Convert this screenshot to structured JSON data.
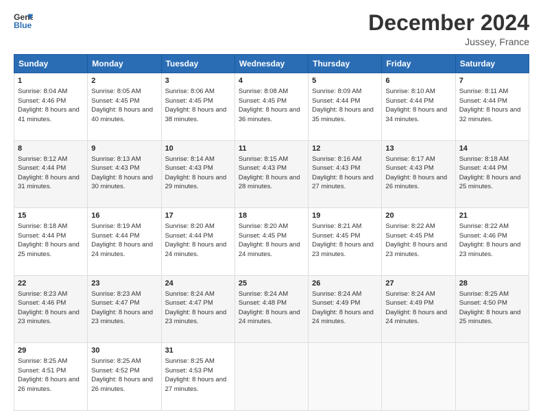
{
  "logo": {
    "line1": "General",
    "line2": "Blue"
  },
  "title": "December 2024",
  "location": "Jussey, France",
  "weekdays": [
    "Sunday",
    "Monday",
    "Tuesday",
    "Wednesday",
    "Thursday",
    "Friday",
    "Saturday"
  ],
  "weeks": [
    [
      {
        "day": "1",
        "sunrise": "8:04 AM",
        "sunset": "4:46 PM",
        "daylight": "8 hours and 41 minutes."
      },
      {
        "day": "2",
        "sunrise": "8:05 AM",
        "sunset": "4:45 PM",
        "daylight": "8 hours and 40 minutes."
      },
      {
        "day": "3",
        "sunrise": "8:06 AM",
        "sunset": "4:45 PM",
        "daylight": "8 hours and 38 minutes."
      },
      {
        "day": "4",
        "sunrise": "8:08 AM",
        "sunset": "4:45 PM",
        "daylight": "8 hours and 36 minutes."
      },
      {
        "day": "5",
        "sunrise": "8:09 AM",
        "sunset": "4:44 PM",
        "daylight": "8 hours and 35 minutes."
      },
      {
        "day": "6",
        "sunrise": "8:10 AM",
        "sunset": "4:44 PM",
        "daylight": "8 hours and 34 minutes."
      },
      {
        "day": "7",
        "sunrise": "8:11 AM",
        "sunset": "4:44 PM",
        "daylight": "8 hours and 32 minutes."
      }
    ],
    [
      {
        "day": "8",
        "sunrise": "8:12 AM",
        "sunset": "4:44 PM",
        "daylight": "8 hours and 31 minutes."
      },
      {
        "day": "9",
        "sunrise": "8:13 AM",
        "sunset": "4:43 PM",
        "daylight": "8 hours and 30 minutes."
      },
      {
        "day": "10",
        "sunrise": "8:14 AM",
        "sunset": "4:43 PM",
        "daylight": "8 hours and 29 minutes."
      },
      {
        "day": "11",
        "sunrise": "8:15 AM",
        "sunset": "4:43 PM",
        "daylight": "8 hours and 28 minutes."
      },
      {
        "day": "12",
        "sunrise": "8:16 AM",
        "sunset": "4:43 PM",
        "daylight": "8 hours and 27 minutes."
      },
      {
        "day": "13",
        "sunrise": "8:17 AM",
        "sunset": "4:43 PM",
        "daylight": "8 hours and 26 minutes."
      },
      {
        "day": "14",
        "sunrise": "8:18 AM",
        "sunset": "4:44 PM",
        "daylight": "8 hours and 25 minutes."
      }
    ],
    [
      {
        "day": "15",
        "sunrise": "8:18 AM",
        "sunset": "4:44 PM",
        "daylight": "8 hours and 25 minutes."
      },
      {
        "day": "16",
        "sunrise": "8:19 AM",
        "sunset": "4:44 PM",
        "daylight": "8 hours and 24 minutes."
      },
      {
        "day": "17",
        "sunrise": "8:20 AM",
        "sunset": "4:44 PM",
        "daylight": "8 hours and 24 minutes."
      },
      {
        "day": "18",
        "sunrise": "8:20 AM",
        "sunset": "4:45 PM",
        "daylight": "8 hours and 24 minutes."
      },
      {
        "day": "19",
        "sunrise": "8:21 AM",
        "sunset": "4:45 PM",
        "daylight": "8 hours and 23 minutes."
      },
      {
        "day": "20",
        "sunrise": "8:22 AM",
        "sunset": "4:45 PM",
        "daylight": "8 hours and 23 minutes."
      },
      {
        "day": "21",
        "sunrise": "8:22 AM",
        "sunset": "4:46 PM",
        "daylight": "8 hours and 23 minutes."
      }
    ],
    [
      {
        "day": "22",
        "sunrise": "8:23 AM",
        "sunset": "4:46 PM",
        "daylight": "8 hours and 23 minutes."
      },
      {
        "day": "23",
        "sunrise": "8:23 AM",
        "sunset": "4:47 PM",
        "daylight": "8 hours and 23 minutes."
      },
      {
        "day": "24",
        "sunrise": "8:24 AM",
        "sunset": "4:47 PM",
        "daylight": "8 hours and 23 minutes."
      },
      {
        "day": "25",
        "sunrise": "8:24 AM",
        "sunset": "4:48 PM",
        "daylight": "8 hours and 24 minutes."
      },
      {
        "day": "26",
        "sunrise": "8:24 AM",
        "sunset": "4:49 PM",
        "daylight": "8 hours and 24 minutes."
      },
      {
        "day": "27",
        "sunrise": "8:24 AM",
        "sunset": "4:49 PM",
        "daylight": "8 hours and 24 minutes."
      },
      {
        "day": "28",
        "sunrise": "8:25 AM",
        "sunset": "4:50 PM",
        "daylight": "8 hours and 25 minutes."
      }
    ],
    [
      {
        "day": "29",
        "sunrise": "8:25 AM",
        "sunset": "4:51 PM",
        "daylight": "8 hours and 26 minutes."
      },
      {
        "day": "30",
        "sunrise": "8:25 AM",
        "sunset": "4:52 PM",
        "daylight": "8 hours and 26 minutes."
      },
      {
        "day": "31",
        "sunrise": "8:25 AM",
        "sunset": "4:53 PM",
        "daylight": "8 hours and 27 minutes."
      },
      null,
      null,
      null,
      null
    ]
  ]
}
